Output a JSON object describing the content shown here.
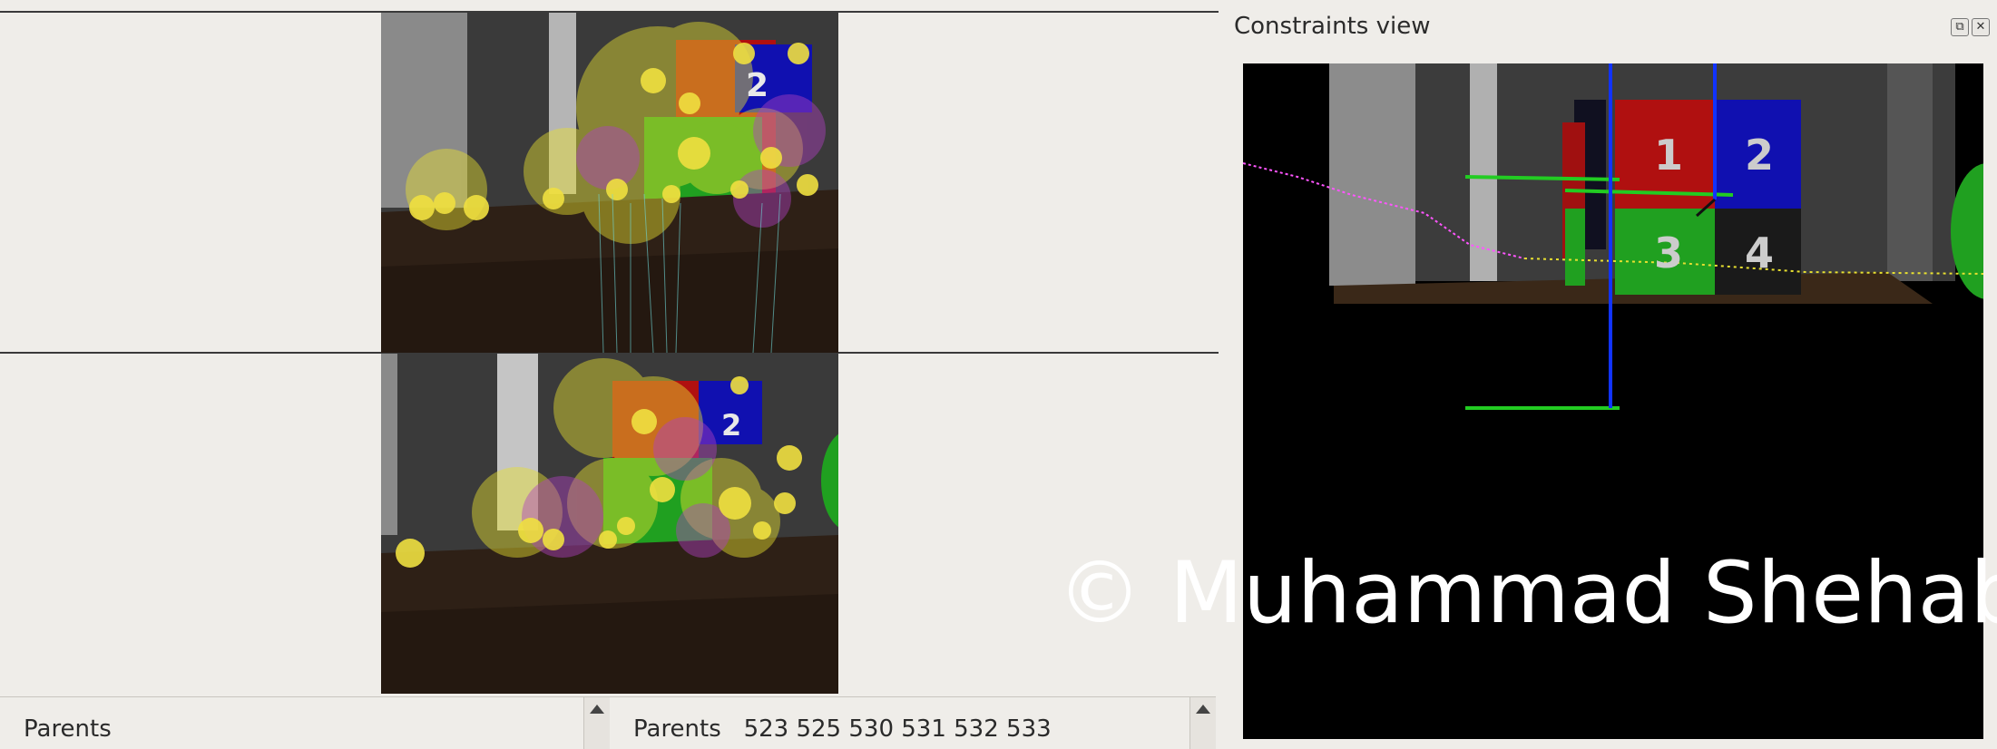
{
  "dock": {
    "title": "Constraints view",
    "restore_button": "⧉",
    "close_button": "✕"
  },
  "panels": {
    "left_parents_label": "Parents",
    "right_parents_label": "Parents",
    "right_parents_ids": "523 525 530 531 532 533"
  },
  "scene": {
    "labels": [
      "1",
      "2",
      "3",
      "4"
    ]
  },
  "watermark": "© Muhammad Shehab",
  "colors": {
    "background": "#efede9",
    "viewport": "#000000",
    "constraint_line_green": "#22cc22",
    "constraint_line_blue": "#1133ff"
  }
}
